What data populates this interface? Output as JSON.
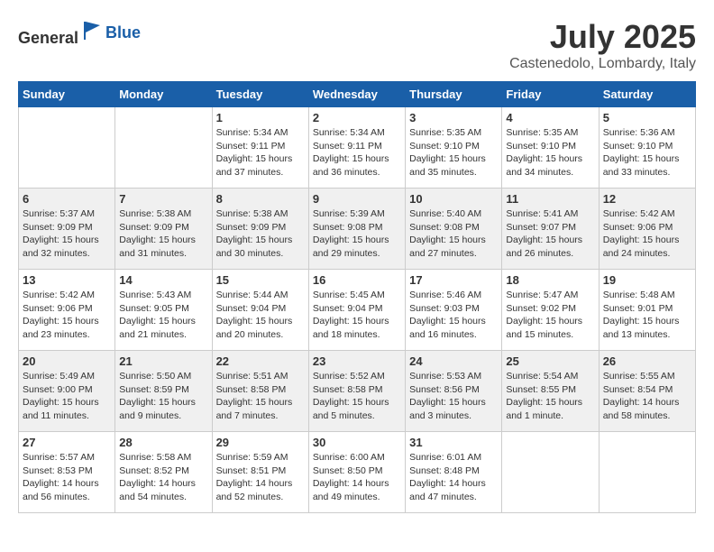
{
  "header": {
    "logo_general": "General",
    "logo_blue": "Blue",
    "month_year": "July 2025",
    "location": "Castenedolo, Lombardy, Italy"
  },
  "days_of_week": [
    "Sunday",
    "Monday",
    "Tuesday",
    "Wednesday",
    "Thursday",
    "Friday",
    "Saturday"
  ],
  "weeks": [
    [
      {
        "day": "",
        "info": ""
      },
      {
        "day": "",
        "info": ""
      },
      {
        "day": "1",
        "info": "Sunrise: 5:34 AM\nSunset: 9:11 PM\nDaylight: 15 hours and 37 minutes."
      },
      {
        "day": "2",
        "info": "Sunrise: 5:34 AM\nSunset: 9:11 PM\nDaylight: 15 hours and 36 minutes."
      },
      {
        "day": "3",
        "info": "Sunrise: 5:35 AM\nSunset: 9:10 PM\nDaylight: 15 hours and 35 minutes."
      },
      {
        "day": "4",
        "info": "Sunrise: 5:35 AM\nSunset: 9:10 PM\nDaylight: 15 hours and 34 minutes."
      },
      {
        "day": "5",
        "info": "Sunrise: 5:36 AM\nSunset: 9:10 PM\nDaylight: 15 hours and 33 minutes."
      }
    ],
    [
      {
        "day": "6",
        "info": "Sunrise: 5:37 AM\nSunset: 9:09 PM\nDaylight: 15 hours and 32 minutes."
      },
      {
        "day": "7",
        "info": "Sunrise: 5:38 AM\nSunset: 9:09 PM\nDaylight: 15 hours and 31 minutes."
      },
      {
        "day": "8",
        "info": "Sunrise: 5:38 AM\nSunset: 9:09 PM\nDaylight: 15 hours and 30 minutes."
      },
      {
        "day": "9",
        "info": "Sunrise: 5:39 AM\nSunset: 9:08 PM\nDaylight: 15 hours and 29 minutes."
      },
      {
        "day": "10",
        "info": "Sunrise: 5:40 AM\nSunset: 9:08 PM\nDaylight: 15 hours and 27 minutes."
      },
      {
        "day": "11",
        "info": "Sunrise: 5:41 AM\nSunset: 9:07 PM\nDaylight: 15 hours and 26 minutes."
      },
      {
        "day": "12",
        "info": "Sunrise: 5:42 AM\nSunset: 9:06 PM\nDaylight: 15 hours and 24 minutes."
      }
    ],
    [
      {
        "day": "13",
        "info": "Sunrise: 5:42 AM\nSunset: 9:06 PM\nDaylight: 15 hours and 23 minutes."
      },
      {
        "day": "14",
        "info": "Sunrise: 5:43 AM\nSunset: 9:05 PM\nDaylight: 15 hours and 21 minutes."
      },
      {
        "day": "15",
        "info": "Sunrise: 5:44 AM\nSunset: 9:04 PM\nDaylight: 15 hours and 20 minutes."
      },
      {
        "day": "16",
        "info": "Sunrise: 5:45 AM\nSunset: 9:04 PM\nDaylight: 15 hours and 18 minutes."
      },
      {
        "day": "17",
        "info": "Sunrise: 5:46 AM\nSunset: 9:03 PM\nDaylight: 15 hours and 16 minutes."
      },
      {
        "day": "18",
        "info": "Sunrise: 5:47 AM\nSunset: 9:02 PM\nDaylight: 15 hours and 15 minutes."
      },
      {
        "day": "19",
        "info": "Sunrise: 5:48 AM\nSunset: 9:01 PM\nDaylight: 15 hours and 13 minutes."
      }
    ],
    [
      {
        "day": "20",
        "info": "Sunrise: 5:49 AM\nSunset: 9:00 PM\nDaylight: 15 hours and 11 minutes."
      },
      {
        "day": "21",
        "info": "Sunrise: 5:50 AM\nSunset: 8:59 PM\nDaylight: 15 hours and 9 minutes."
      },
      {
        "day": "22",
        "info": "Sunrise: 5:51 AM\nSunset: 8:58 PM\nDaylight: 15 hours and 7 minutes."
      },
      {
        "day": "23",
        "info": "Sunrise: 5:52 AM\nSunset: 8:58 PM\nDaylight: 15 hours and 5 minutes."
      },
      {
        "day": "24",
        "info": "Sunrise: 5:53 AM\nSunset: 8:56 PM\nDaylight: 15 hours and 3 minutes."
      },
      {
        "day": "25",
        "info": "Sunrise: 5:54 AM\nSunset: 8:55 PM\nDaylight: 15 hours and 1 minute."
      },
      {
        "day": "26",
        "info": "Sunrise: 5:55 AM\nSunset: 8:54 PM\nDaylight: 14 hours and 58 minutes."
      }
    ],
    [
      {
        "day": "27",
        "info": "Sunrise: 5:57 AM\nSunset: 8:53 PM\nDaylight: 14 hours and 56 minutes."
      },
      {
        "day": "28",
        "info": "Sunrise: 5:58 AM\nSunset: 8:52 PM\nDaylight: 14 hours and 54 minutes."
      },
      {
        "day": "29",
        "info": "Sunrise: 5:59 AM\nSunset: 8:51 PM\nDaylight: 14 hours and 52 minutes."
      },
      {
        "day": "30",
        "info": "Sunrise: 6:00 AM\nSunset: 8:50 PM\nDaylight: 14 hours and 49 minutes."
      },
      {
        "day": "31",
        "info": "Sunrise: 6:01 AM\nSunset: 8:48 PM\nDaylight: 14 hours and 47 minutes."
      },
      {
        "day": "",
        "info": ""
      },
      {
        "day": "",
        "info": ""
      }
    ]
  ]
}
